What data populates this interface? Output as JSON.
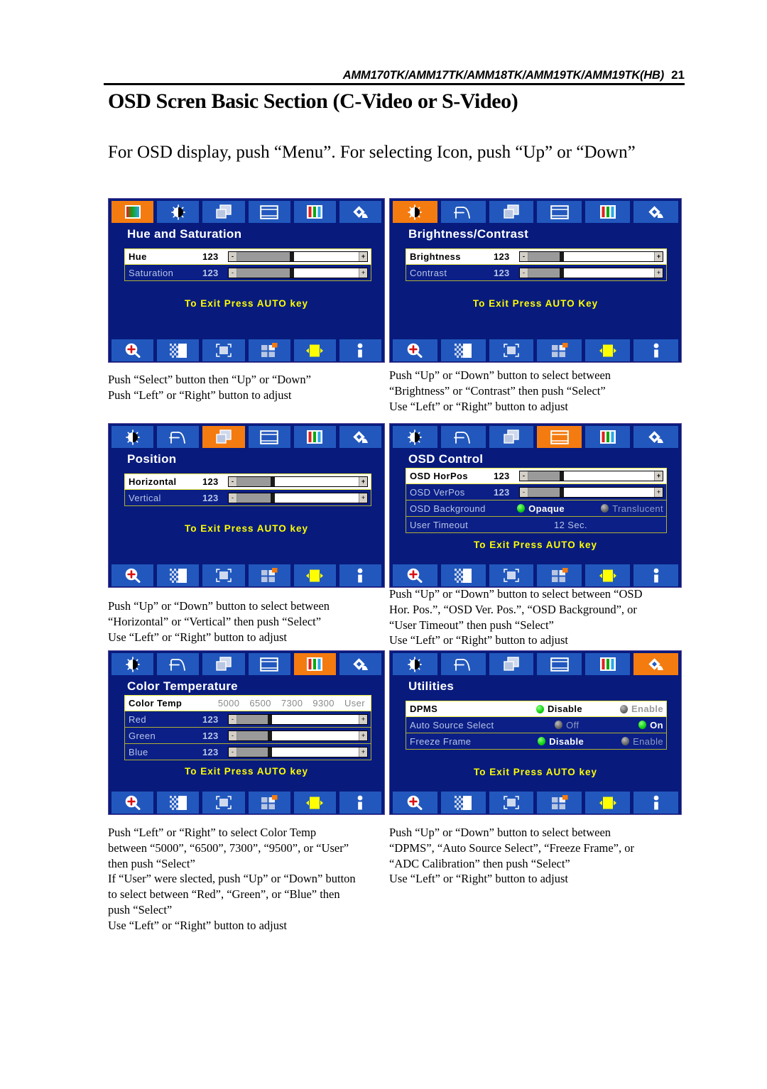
{
  "header": {
    "models": "AMM170TK/AMM17TK/AMM18TK/AMM19TK/AMM19TK(HB)",
    "page_number": "21"
  },
  "title": "OSD Scren Basic Section (C-Video or S-Video)",
  "intro": "For OSD display, push “Menu”.  For selecting Icon, push “Up” or “Down”",
  "exit_hints": {
    "key_lower": "To Exit Press AUTO key",
    "key_upper": "To Exit Press AUTO Key"
  },
  "icons": {
    "top_set_a": [
      "color-bars-icon",
      "brightness-icon",
      "position-icon",
      "osd-control-icon",
      "rgb-bars-icon",
      "utilities-icon"
    ],
    "top_set_b": [
      "brightness-icon",
      "clock-phase-icon",
      "position-icon",
      "osd-control-icon",
      "rgb-bars-icon",
      "utilities-icon"
    ],
    "bottom_set": [
      "zoom-in-icon",
      "dither-icon",
      "auto-adjust-icon",
      "tiles-icon",
      "sharpness-icon",
      "info-icon"
    ]
  },
  "panels": {
    "hue_saturation": {
      "title": "Hue  and  Saturation",
      "active_icon_index": 0,
      "rows": [
        {
          "label": "Hue",
          "value": "123",
          "selected": true,
          "type": "slider",
          "fill": 38
        },
        {
          "label": "Saturation",
          "value": "123",
          "selected": false,
          "type": "slider",
          "fill": 38
        }
      ],
      "exit_hint": "To Exit Press AUTO key"
    },
    "brightness_contrast": {
      "title": "Brightness/Contrast",
      "active_icon_index": 0,
      "rows": [
        {
          "label": "Brightness",
          "value": "123",
          "selected": true,
          "type": "slider",
          "fill": 22
        },
        {
          "label": "Contrast",
          "value": "123",
          "selected": false,
          "type": "slider",
          "fill": 22
        }
      ],
      "exit_hint": "To Exit Press AUTO Key"
    },
    "position": {
      "title": "Position",
      "active_icon_index": 2,
      "rows": [
        {
          "label": "Horizontal",
          "value": "123",
          "selected": true,
          "type": "slider",
          "fill": 24
        },
        {
          "label": "Vertical",
          "value": "123",
          "selected": false,
          "type": "slider",
          "fill": 24
        }
      ],
      "exit_hint": "To Exit Press AUTO key"
    },
    "osd_control": {
      "title": "OSD  Control",
      "active_icon_index": 3,
      "rows": [
        {
          "label": "OSD HorPos",
          "value": "123",
          "selected": true,
          "type": "slider",
          "fill": 22
        },
        {
          "label": "OSD VerPos",
          "value": "123",
          "selected": false,
          "type": "slider",
          "fill": 22
        },
        {
          "label": "OSD Background",
          "selected": false,
          "type": "radio",
          "options": [
            {
              "label": "Opaque",
              "on": true
            },
            {
              "label": "Translucent",
              "on": false
            }
          ]
        },
        {
          "label": "User Timeout",
          "selected": false,
          "type": "value",
          "value": "12 Sec."
        }
      ],
      "exit_hint": "To Exit Press AUTO key"
    },
    "color_temperature": {
      "title": "Color  Temperature",
      "active_icon_index": 4,
      "rows": [
        {
          "label": "Color Temp",
          "selected": true,
          "type": "choices",
          "choices": [
            {
              "label": "5000",
              "on": false
            },
            {
              "label": "6500",
              "on": false
            },
            {
              "label": "7300",
              "on": false
            },
            {
              "label": "9300",
              "on": false
            },
            {
              "label": "User",
              "on": true
            }
          ]
        },
        {
          "label": "Red",
          "value": "123",
          "selected": false,
          "type": "slider",
          "fill": 22
        },
        {
          "label": "Green",
          "value": "123",
          "selected": false,
          "type": "slider",
          "fill": 22
        },
        {
          "label": "Blue",
          "value": "123",
          "selected": false,
          "type": "slider",
          "fill": 22
        }
      ],
      "exit_hint": "To Exit Press AUTO key"
    },
    "utilities": {
      "title": "Utilities",
      "active_icon_index": 5,
      "rows": [
        {
          "label": "DPMS",
          "selected": true,
          "type": "radio",
          "options": [
            {
              "label": "Disable",
              "on": true
            },
            {
              "label": "Enable",
              "on": false
            }
          ]
        },
        {
          "label": "Auto Source Select",
          "selected": false,
          "type": "radio",
          "options": [
            {
              "label": "Off",
              "on": false
            },
            {
              "label": "On",
              "on": true
            }
          ]
        },
        {
          "label": "Freeze Frame",
          "selected": false,
          "type": "radio",
          "options": [
            {
              "label": "Disable",
              "on": true
            },
            {
              "label": "Enable",
              "on": false
            }
          ]
        }
      ],
      "exit_hint": "To Exit Press AUTO key"
    }
  },
  "captions": {
    "hue_saturation": [
      "Push “Select” button then “Up” or “Down”",
      "Push “Left” or “Right” button to adjust"
    ],
    "brightness_contrast": [
      "Push “Up” or “Down” button to select between",
      "“Brightness” or “Contrast” then push “Select”",
      "Use “Left” or “Right” button to adjust"
    ],
    "position": [
      "Push “Up” or “Down” button to select between",
      "“Horizontal” or “Vertical” then push “Select”",
      "Use “Left” or “Right” button to adjust"
    ],
    "osd_control": [
      "Push “Up” or “Down” button to select between “OSD",
      "Hor. Pos.”, “OSD Ver. Pos.”, “OSD Background”, or",
      "“User Timeout” then push “Select”",
      "Use “Left” or “Right” button to adjust"
    ],
    "color_temperature": [
      "Push “Left” or “Right” to select Color Temp",
      "between “5000”, “6500”, 7300”, “9500”, or “User”",
      "then push “Select”",
      "If “User” were slected, push “Up” or “Down” button",
      "to select between “Red”, “Green”, or “Blue” then",
      "push “Select”",
      "Use “Left” or “Right” button to adjust"
    ],
    "utilities": [
      "Push “Up” or “Down” button to select between",
      "“DPMS”, “Auto Source Select”, “Freeze Frame”, or",
      "“ADC Calibration” then push “Select”",
      "Use “Left” or “Right” button to adjust"
    ]
  },
  "colors": {
    "osd_background": "#081b7d",
    "icon_tile": "#2258bd",
    "icon_active": "#f47b10",
    "hint_yellow": "#ffff00",
    "row_border": "#b0b030",
    "row_border_selected": "#e8e840"
  }
}
